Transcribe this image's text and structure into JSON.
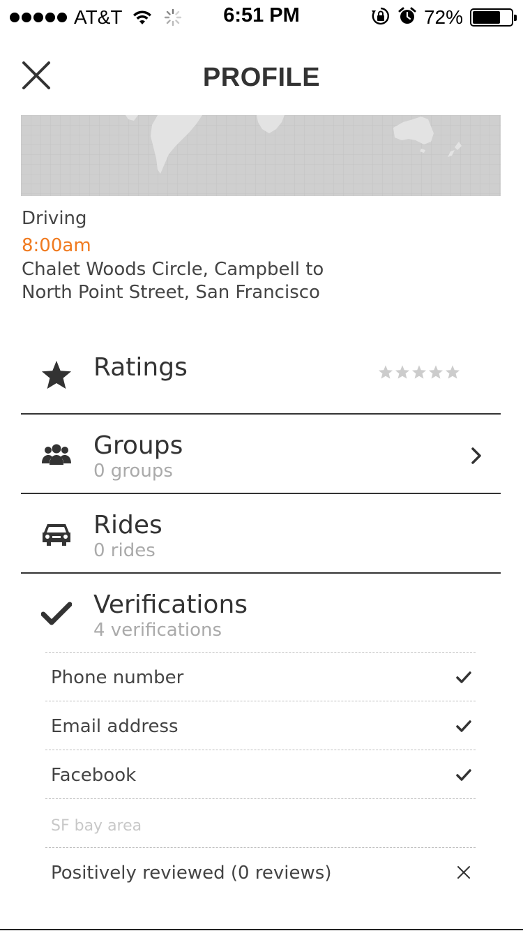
{
  "status_bar": {
    "signal_bars": 5,
    "carrier": "AT&T",
    "time": "6:51 PM",
    "battery_percent": "72%",
    "battery_level": 0.72,
    "icons": [
      "wifi-icon",
      "loading-spinner-icon",
      "orientation-lock-icon",
      "alarm-icon",
      "battery-icon"
    ]
  },
  "header": {
    "title": "PROFILE",
    "close_icon": "close-icon"
  },
  "trip": {
    "mode": "Driving",
    "time": "8:00am",
    "route": "Chalet Woods Circle, Campbell to North Point Street, San Francisco"
  },
  "sections": {
    "ratings": {
      "title": "Ratings",
      "icon": "star-icon",
      "rating_stars": 5,
      "filled_stars": 0
    },
    "groups": {
      "title": "Groups",
      "subtitle": "0 groups",
      "icon": "group-icon"
    },
    "rides": {
      "title": "Rides",
      "subtitle": "0 rides",
      "icon": "car-icon"
    },
    "verifications": {
      "title": "Verifications",
      "subtitle": "4 verifications",
      "icon": "checkmark-icon"
    }
  },
  "verification_items": [
    {
      "label": "Phone number",
      "status": "verified"
    },
    {
      "label": "Email address",
      "status": "verified"
    },
    {
      "label": "Facebook",
      "status": "verified"
    },
    {
      "label": "SF bay area",
      "status": "muted"
    },
    {
      "label": "Positively reviewed (0 reviews)",
      "status": "not-verified"
    }
  ],
  "colors": {
    "accent": "#f07a1f",
    "text": "#333333",
    "muted": "#aaaaaa",
    "map_bg": "#cfcfcf",
    "star_empty": "#cccccc"
  }
}
